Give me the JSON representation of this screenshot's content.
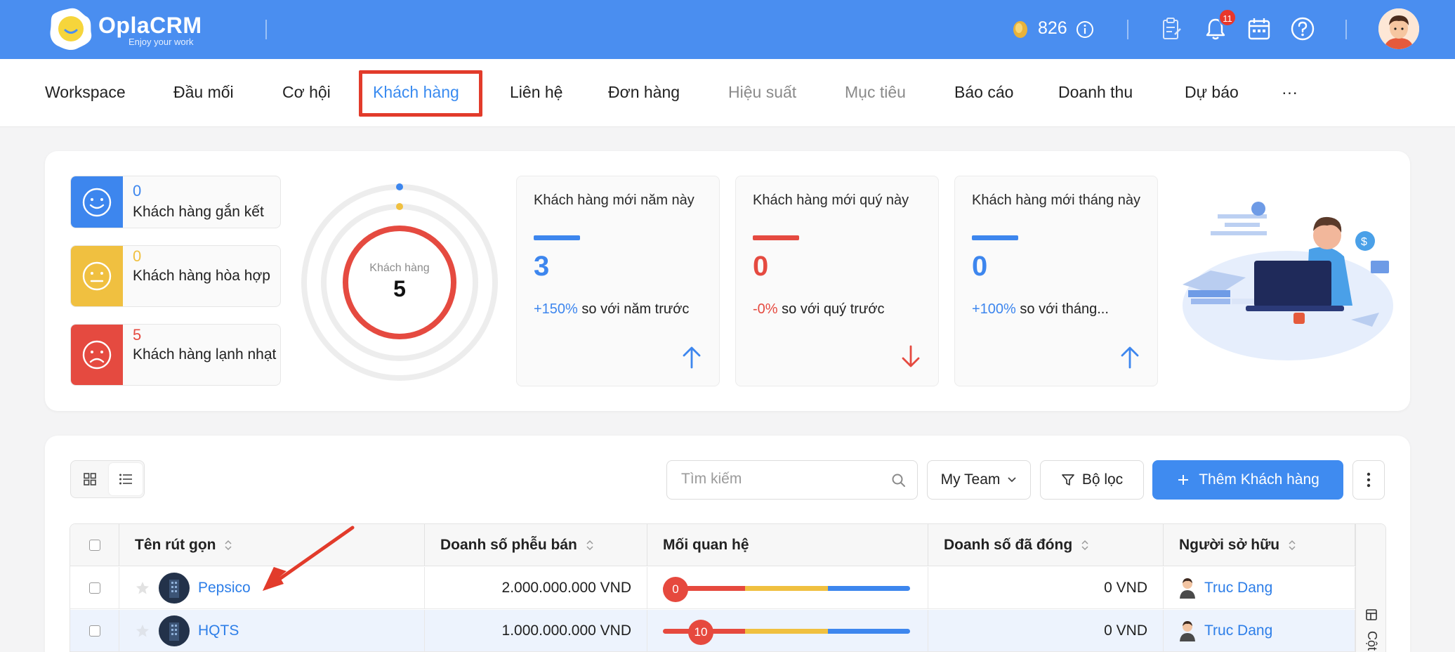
{
  "header": {
    "brand": "OplaCRM",
    "tagline": "Enjoy your work",
    "coins": "826",
    "notification_count": "11"
  },
  "nav": {
    "items": [
      {
        "label": "Workspace",
        "state": "normal"
      },
      {
        "label": "Đầu mối",
        "state": "normal"
      },
      {
        "label": "Cơ hội",
        "state": "normal"
      },
      {
        "label": "Khách hàng",
        "state": "active"
      },
      {
        "label": "Liên hệ",
        "state": "normal"
      },
      {
        "label": "Đơn hàng",
        "state": "normal"
      },
      {
        "label": "Hiệu suất",
        "state": "muted"
      },
      {
        "label": "Mục tiêu",
        "state": "muted"
      },
      {
        "label": "Báo cáo",
        "state": "normal"
      },
      {
        "label": "Doanh thu",
        "state": "normal"
      },
      {
        "label": "Dự báo",
        "state": "normal"
      },
      {
        "label": "···",
        "state": "normal"
      }
    ]
  },
  "stats": {
    "relationships": [
      {
        "count": "0",
        "label": "Khách hàng gắn kết",
        "color": "#3d86ee",
        "mood": "happy"
      },
      {
        "count": "0",
        "label": "Khách hàng hòa hợp",
        "color": "#f0c040",
        "mood": "neutral"
      },
      {
        "count": "5",
        "label": "Khách hàng lạnh nhạt",
        "color": "#e54a40",
        "mood": "sad"
      }
    ],
    "donut": {
      "label": "Khách hàng",
      "value": "5"
    },
    "kpis": [
      {
        "title": "Khách hàng mới năm này",
        "value": "3",
        "change": "+150%",
        "compare": " so với năm trước",
        "color": "#3d86ee",
        "trend": "up"
      },
      {
        "title": "Khách hàng mới quý này",
        "value": "0",
        "change": "-0%",
        "compare": " so với quý trước",
        "color": "#e54a40",
        "trend": "down"
      },
      {
        "title": "Khách hàng mới tháng này",
        "value": "0",
        "change": "+100%",
        "compare": " so với tháng...",
        "color": "#3d86ee",
        "trend": "up"
      }
    ]
  },
  "toolbar": {
    "search_placeholder": "Tìm kiếm",
    "team_label": "My Team",
    "filter_label": "Bộ lọc",
    "add_label": "Thêm Khách hàng"
  },
  "table": {
    "columns": [
      "Tên rút gọn",
      "Doanh số phễu bán",
      "Mối quan hệ",
      "Doanh số đã đóng",
      "Người sở hữu"
    ],
    "side_label": "Cột",
    "rows": [
      {
        "name": "Pepsico",
        "pipeline": "2.000.000.000 VND",
        "relationship": 0,
        "closed": "0 VND",
        "owner": "Truc Dang"
      },
      {
        "name": "HQTS",
        "pipeline": "1.000.000.000 VND",
        "relationship": 10,
        "closed": "0 VND",
        "owner": "Truc Dang"
      }
    ]
  }
}
